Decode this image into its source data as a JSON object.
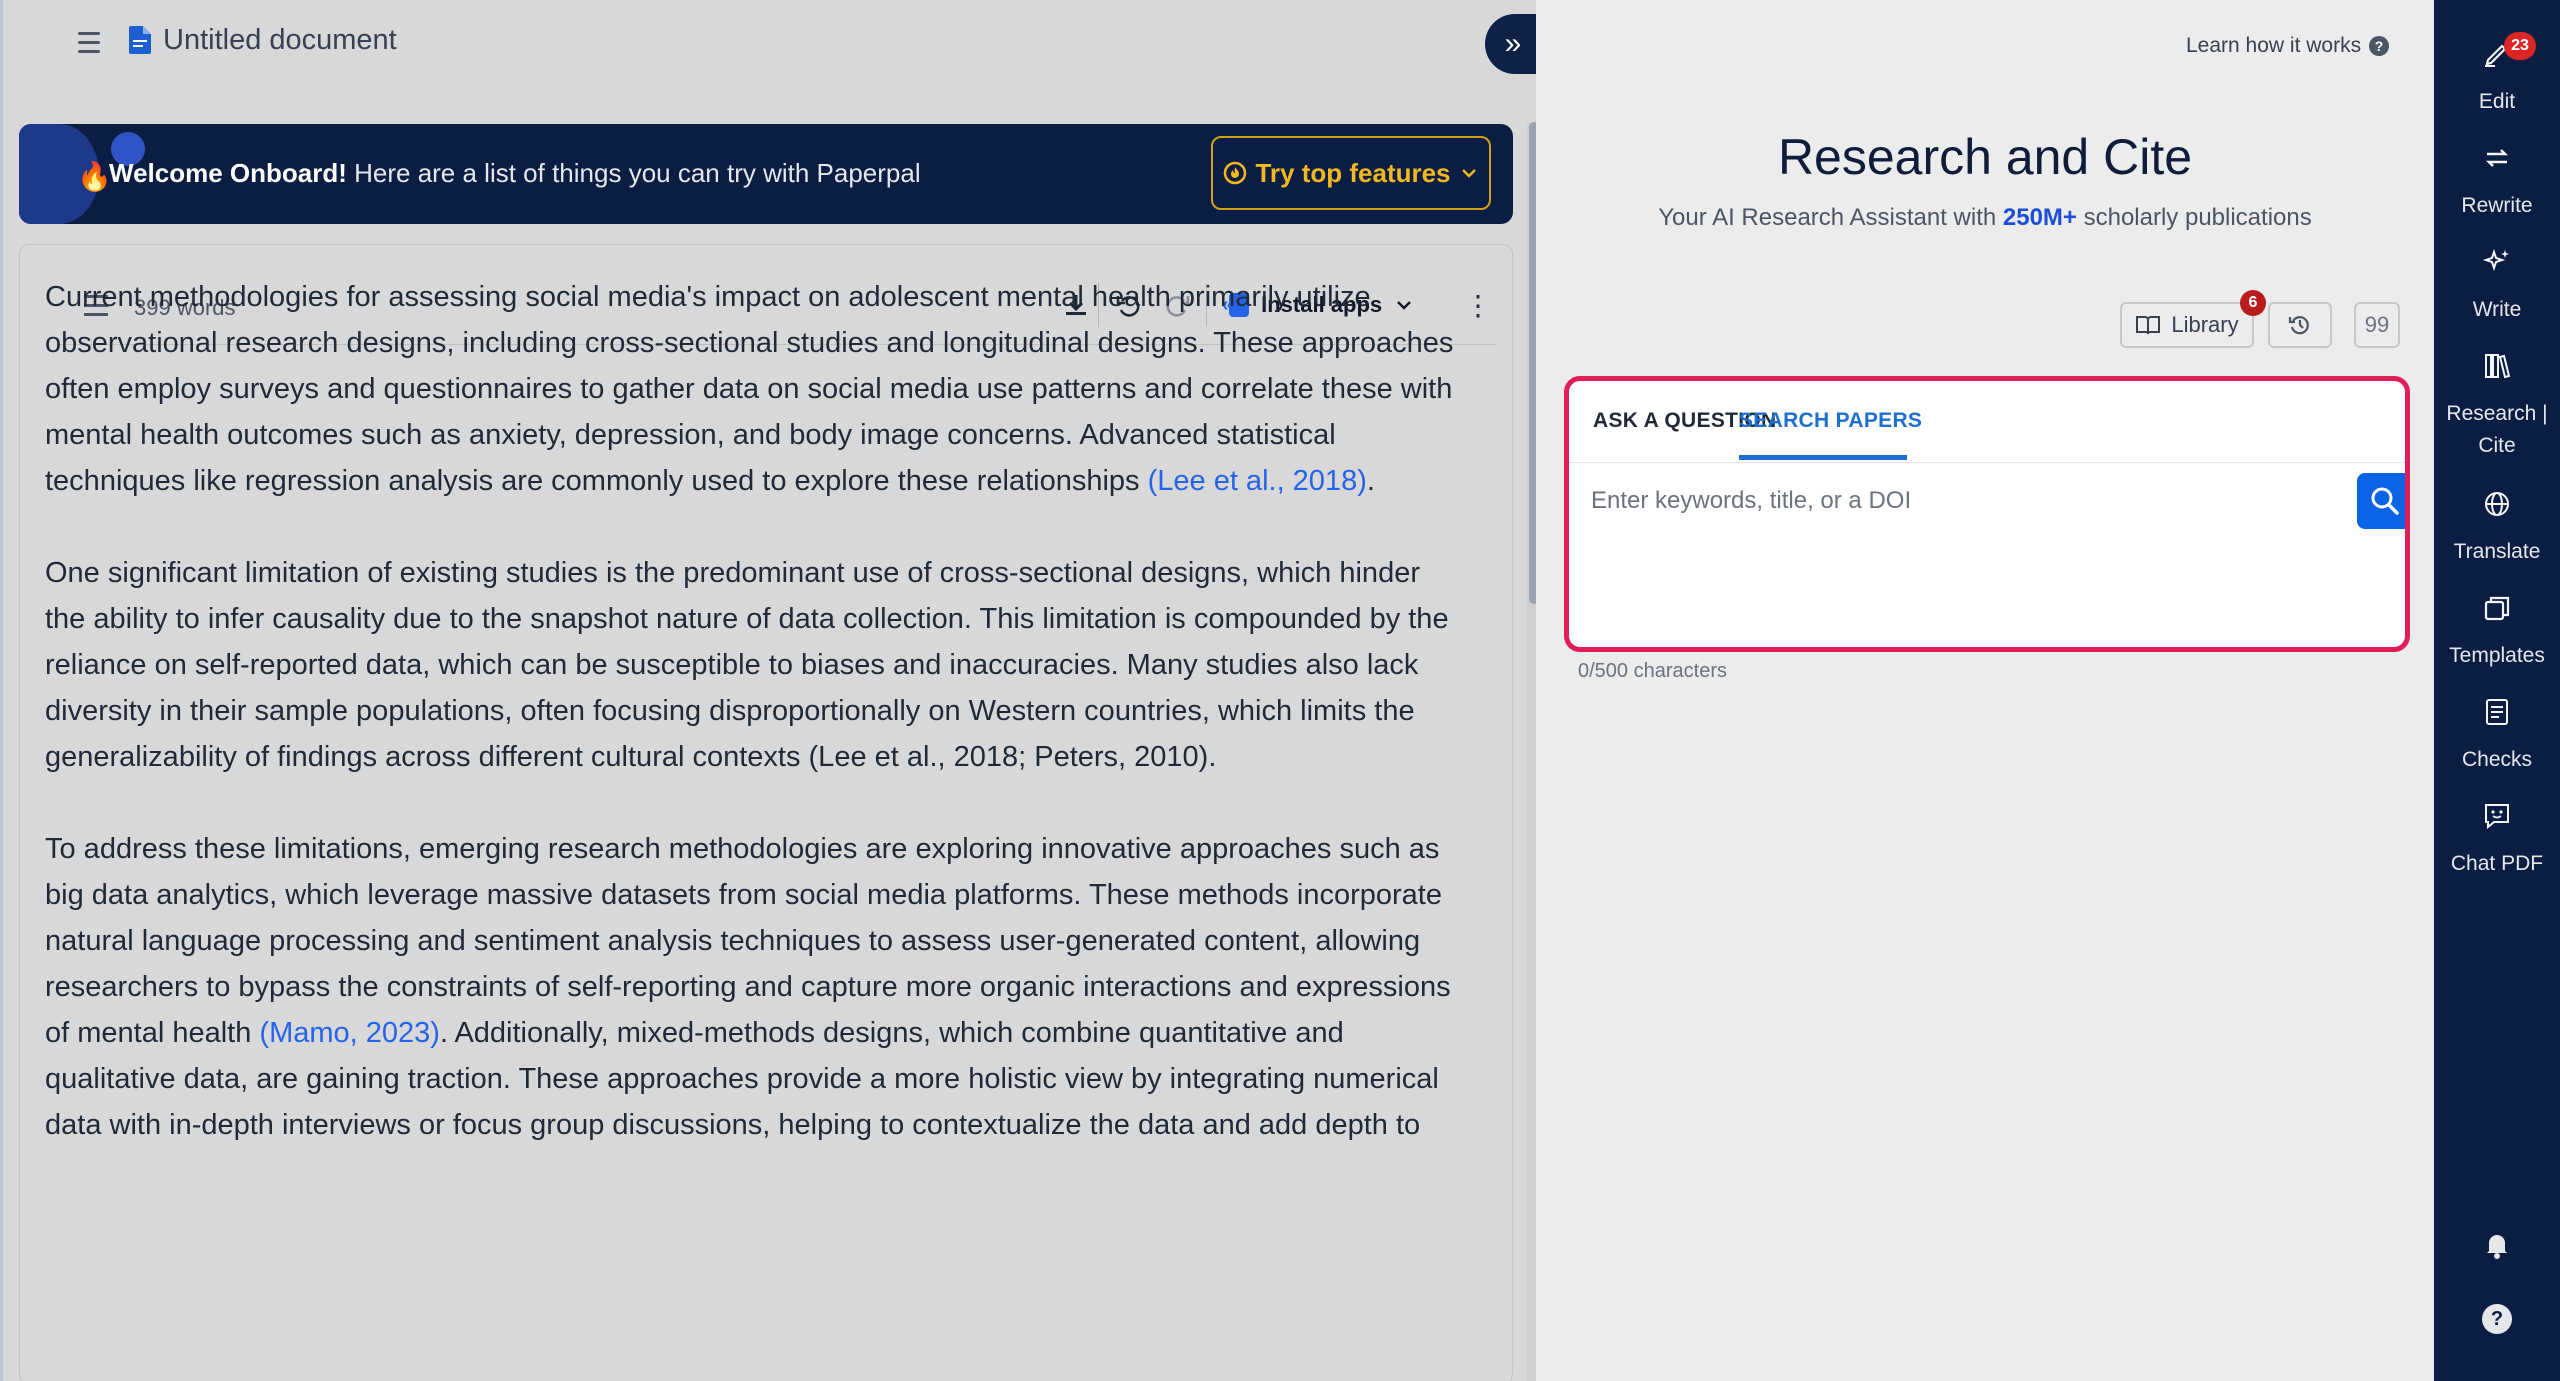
{
  "header": {
    "doc_title": "Untitled document"
  },
  "banner": {
    "bold": "Welcome Onboard!",
    "text": " Here are a list of things you can try with Paperpal",
    "cta_label": "Try top features"
  },
  "toolbar": {
    "word_count": "399 words",
    "install_apps_label": "Install apps"
  },
  "document": {
    "p1_text": "Current methodologies for assessing social media's impact on adolescent mental health primarily utilize observational research designs, including cross-sectional studies and longitudinal designs. These approaches often employ surveys and questionnaires to gather data on social media use patterns and correlate these with mental health outcomes such as anxiety, depression, and body image concerns. Advanced statistical techniques like regression analysis are commonly used to explore these relationships ",
    "p1_cite": "(Lee et al., 2018)",
    "p1_end": ".",
    "p2_text": "One significant limitation of existing studies is the predominant use of cross-sectional designs, which hinder the ability to infer causality due to the snapshot nature of data collection. This limitation is compounded by the reliance on self-reported data, which can be susceptible to biases and inaccuracies. Many studies also lack diversity in their sample populations, often focusing disproportionally on Western countries, which limits the generalizability of findings across different cultural contexts (Lee et al., 2018; Peters, 2010).",
    "p3_text": "To address these limitations, emerging research methodologies are exploring innovative approaches such as big data analytics, which leverage massive datasets from social media platforms. These methods incorporate natural language processing and sentiment analysis techniques to assess user-generated content, allowing researchers to bypass the constraints of self-reporting and capture more organic interactions and expressions of mental health ",
    "p3_cite": "(Mamo, 2023)",
    "p3_end": ". Additionally, mixed-methods designs, which combine quantitative and qualitative data, are gaining traction. These approaches provide a more holistic view by integrating numerical data with in-depth interviews or focus group discussions, helping to contextualize the data and add depth to"
  },
  "research": {
    "learn_link": "Learn how it works",
    "title": "Research and Cite",
    "subtitle_before": "Your AI Research Assistant with ",
    "subtitle_highlight": "250M+",
    "subtitle_after": " scholarly publications",
    "library_label": "Library",
    "library_badge": "6",
    "quote_label": "99",
    "tab_ask": "ASK A QUESTION",
    "tab_search": "SEARCH PAPERS",
    "search_placeholder": "Enter keywords, title, or a DOI",
    "char_count": "0/500 characters"
  },
  "sidenav": {
    "edit_badge": "23",
    "items": [
      {
        "label": "Edit",
        "icon": "pen-icon"
      },
      {
        "label": "Rewrite",
        "icon": "rewrite-icon"
      },
      {
        "label": "Write",
        "icon": "sparkle-icon"
      },
      {
        "label": "Research | Cite",
        "icon": "books-icon"
      },
      {
        "label": "Translate",
        "icon": "globe-icon"
      },
      {
        "label": "Templates",
        "icon": "templates-icon"
      },
      {
        "label": "Checks",
        "icon": "checklist-icon"
      },
      {
        "label": "Chat PDF",
        "icon": "chat-icon"
      }
    ]
  },
  "colors": {
    "navy": "#0c1d43",
    "accent_blue": "#1d6fd1",
    "highlight_border": "#e11d5a",
    "cta_gold": "#f2b81f"
  }
}
